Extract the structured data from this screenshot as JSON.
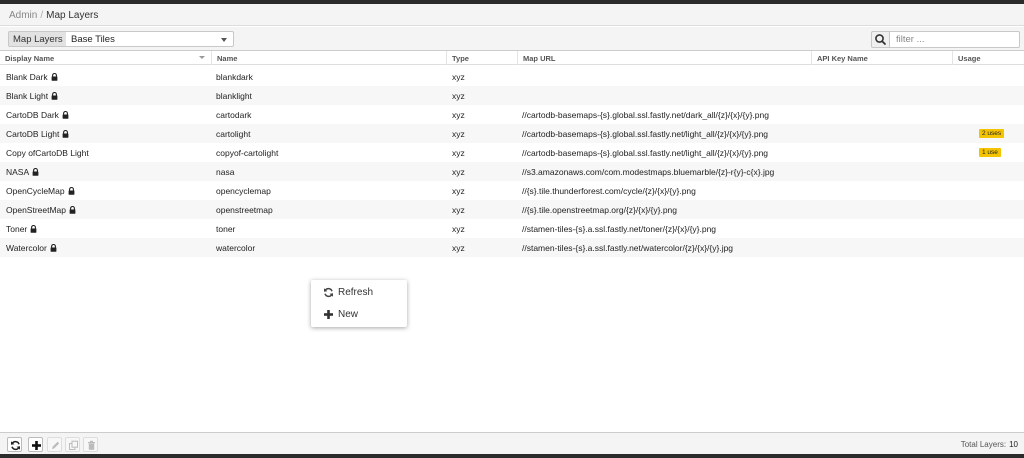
{
  "breadcrumb": {
    "parent": "Admin",
    "separator": "/",
    "current": "Map Layers"
  },
  "toolbar": {
    "label": "Map Layers",
    "selected_option": "Base Tiles",
    "search_placeholder": "filter ..."
  },
  "columns": [
    "Display Name",
    "Name",
    "Type",
    "Map URL",
    "API Key Name",
    "Usage"
  ],
  "rows": [
    {
      "display_name": "Blank Dark",
      "locked": true,
      "name": "blankdark",
      "type": "xyz",
      "url": "",
      "api_key": "",
      "usage": ""
    },
    {
      "display_name": "Blank Light",
      "locked": true,
      "name": "blanklight",
      "type": "xyz",
      "url": "",
      "api_key": "",
      "usage": ""
    },
    {
      "display_name": "CartoDB Dark",
      "locked": true,
      "name": "cartodark",
      "type": "xyz",
      "url": "//cartodb-basemaps-{s}.global.ssl.fastly.net/dark_all/{z}/{x}/{y}.png",
      "api_key": "",
      "usage": ""
    },
    {
      "display_name": "CartoDB Light",
      "locked": true,
      "name": "cartolight",
      "type": "xyz",
      "url": "//cartodb-basemaps-{s}.global.ssl.fastly.net/light_all/{z}/{x}/{y}.png",
      "api_key": "",
      "usage": "2 uses"
    },
    {
      "display_name": "Copy ofCartoDB Light",
      "locked": false,
      "name": "copyof-cartolight",
      "type": "xyz",
      "url": "//cartodb-basemaps-{s}.global.ssl.fastly.net/light_all/{z}/{x}/{y}.png",
      "api_key": "",
      "usage": "1 use"
    },
    {
      "display_name": "NASA",
      "locked": true,
      "name": "nasa",
      "type": "xyz",
      "url": "//s3.amazonaws.com/com.modestmaps.bluemarble/{z}-r{y}-c{x}.jpg",
      "api_key": "",
      "usage": ""
    },
    {
      "display_name": "OpenCycleMap",
      "locked": true,
      "name": "opencyclemap",
      "type": "xyz",
      "url": "//{s}.tile.thunderforest.com/cycle/{z}/{x}/{y}.png",
      "api_key": "",
      "usage": ""
    },
    {
      "display_name": "OpenStreetMap",
      "locked": true,
      "name": "openstreetmap",
      "type": "xyz",
      "url": "//{s}.tile.openstreetmap.org/{z}/{x}/{y}.png",
      "api_key": "",
      "usage": ""
    },
    {
      "display_name": "Toner",
      "locked": true,
      "name": "toner",
      "type": "xyz",
      "url": "//stamen-tiles-{s}.a.ssl.fastly.net/toner/{z}/{x}/{y}.png",
      "api_key": "",
      "usage": ""
    },
    {
      "display_name": "Watercolor",
      "locked": true,
      "name": "watercolor",
      "type": "xyz",
      "url": "//stamen-tiles-{s}.a.ssl.fastly.net/watercolor/{z}/{x}/{y}.jpg",
      "api_key": "",
      "usage": ""
    }
  ],
  "context_menu": {
    "refresh": "Refresh",
    "new": "New"
  },
  "footer": {
    "total_label": "Total Layers:",
    "total_value": "10"
  },
  "colors": {
    "usage_badge": "#f5c400",
    "chrome": "#2b2b2b"
  },
  "icons": [
    "search-icon",
    "lock-icon",
    "refresh-icon",
    "plus-icon",
    "edit-icon",
    "copy-icon",
    "trash-icon"
  ]
}
